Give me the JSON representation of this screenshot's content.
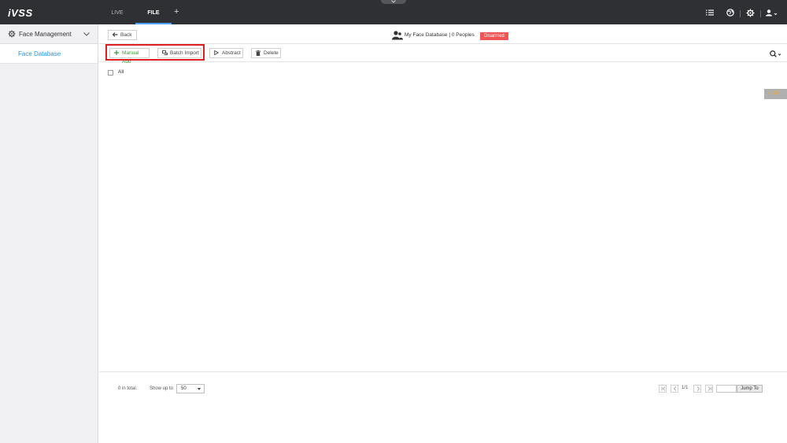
{
  "app": {
    "logo": "iVSS"
  },
  "nav": {
    "tabs": [
      {
        "label": "LIVE"
      },
      {
        "label": "FILE"
      }
    ],
    "add_label": "+"
  },
  "sidebar": {
    "section": {
      "label": "Face Management",
      "icon": "gear-icon"
    },
    "items": [
      {
        "label": "Face Database",
        "active": true
      }
    ]
  },
  "header": {
    "back_label": "Back",
    "db_title": "My Face Database | 0 Peoples",
    "status_badge": "Disarmed"
  },
  "toolbar": {
    "manual_add": "Manual Add",
    "batch_import": "Batch Import",
    "abstract": "Abstract",
    "delete": "Delete"
  },
  "list": {
    "all_label": "All",
    "all_checked": false
  },
  "side_tag": "⚠ 29",
  "footer": {
    "total": "0 in total.",
    "show_up_to": "Show up to",
    "page_size": "50",
    "page": "1/1",
    "jump_label": "Jump To"
  },
  "colors": {
    "topbar": "#2f3033",
    "accent": "#2196e8",
    "badge": "#f05454",
    "highlight": "#e02020",
    "add_green": "#3a9a3a"
  }
}
